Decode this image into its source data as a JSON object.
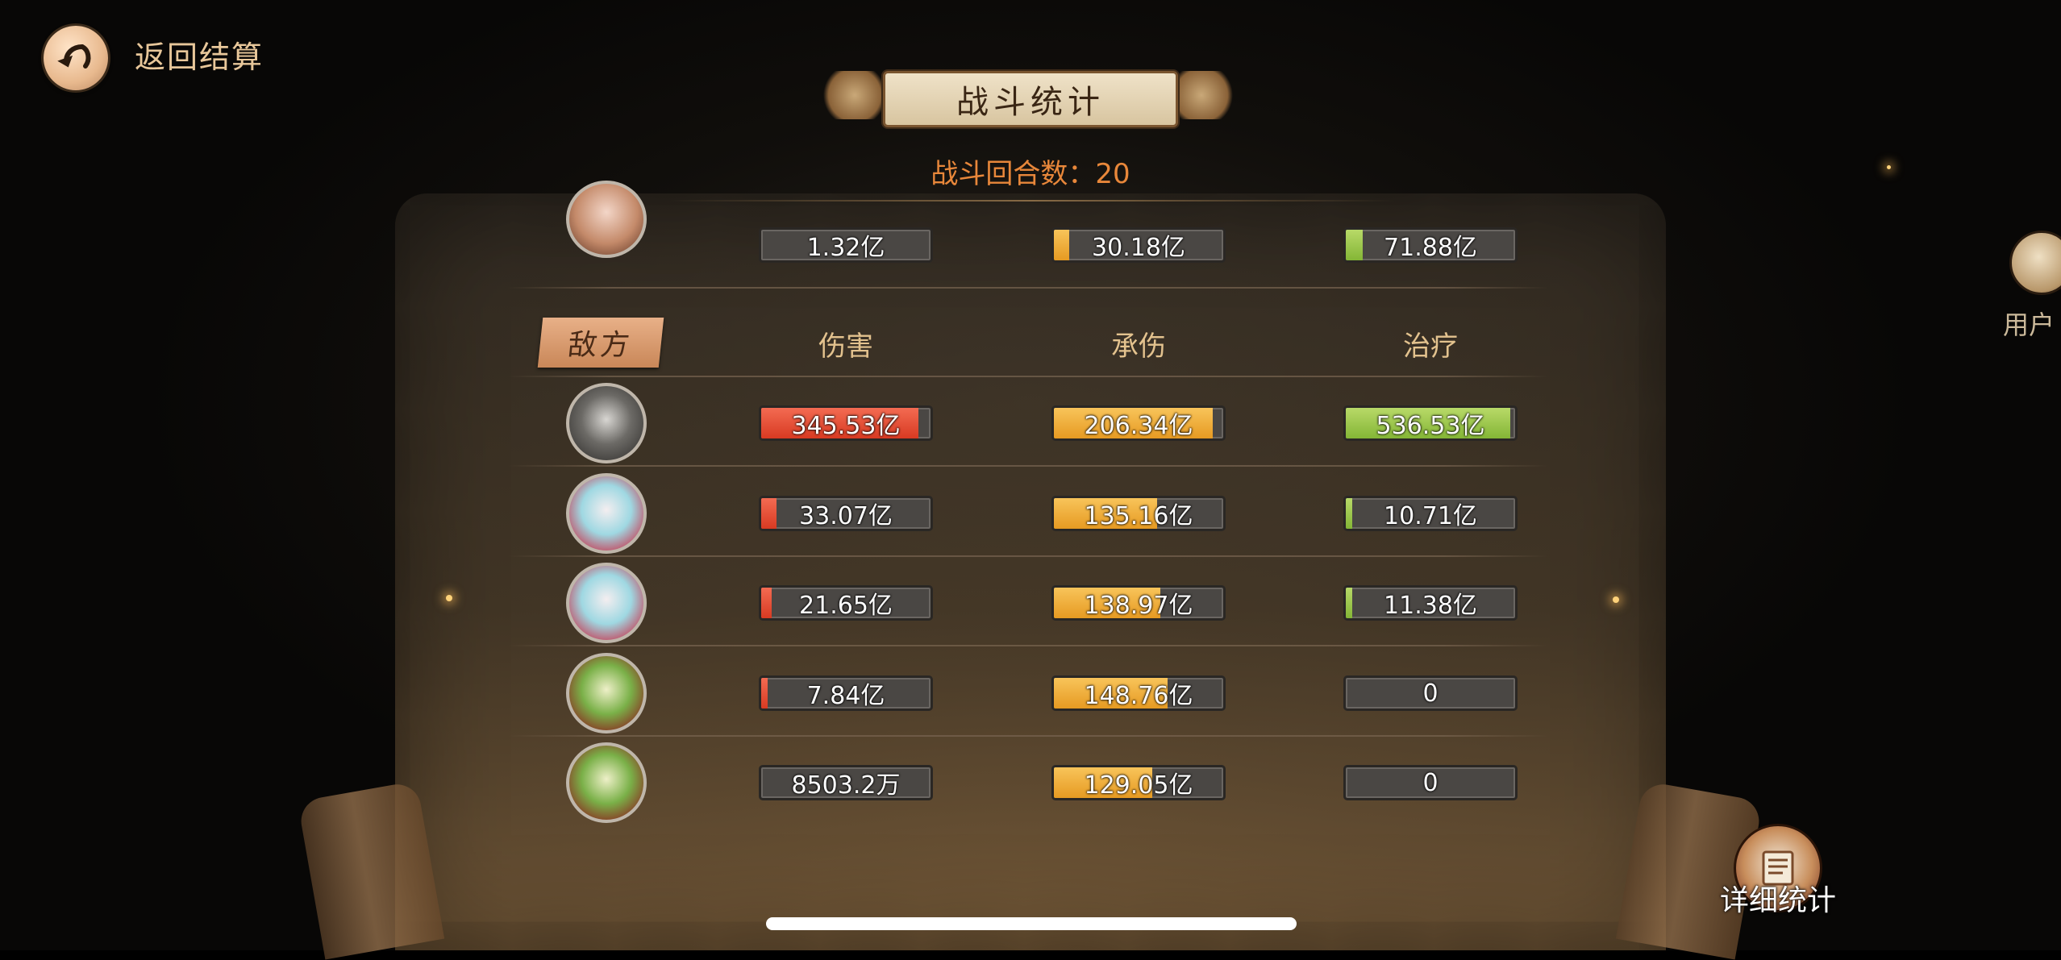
{
  "header": {
    "back_label": "返回结算",
    "title": "战斗统计",
    "rounds_label": "战斗回合数：20"
  },
  "colors": {
    "damage": "#e04a30",
    "taken": "#f0ad3a",
    "healing": "#a6cc52",
    "accent_text": "#e8873a",
    "header_text": "#e3c28e"
  },
  "ally_last_row": {
    "avatar_icon": "female-portrait-icon",
    "damage": {
      "text": "1.32亿",
      "fill": 0
    },
    "taken": {
      "text": "30.18亿",
      "fill": 0.09
    },
    "healing": {
      "text": "71.88亿",
      "fill": 0.1
    }
  },
  "enemy_section": {
    "tag": "敌方",
    "columns": {
      "damage": "伤害",
      "taken": "承伤",
      "healing": "治疗"
    },
    "rows": [
      {
        "avatar_icon": "stone-orbs-boss-icon",
        "damage": {
          "text": "345.53亿",
          "fill": 0.93
        },
        "taken": {
          "text": "206.34亿",
          "fill": 0.94
        },
        "healing": {
          "text": "536.53亿",
          "fill": 0.97
        }
      },
      {
        "avatar_icon": "cyan-hair-girl-icon",
        "damage": {
          "text": "33.07亿",
          "fill": 0.09
        },
        "taken": {
          "text": "135.16亿",
          "fill": 0.61
        },
        "healing": {
          "text": "10.71亿",
          "fill": 0.02
        }
      },
      {
        "avatar_icon": "cyan-hair-girl-icon",
        "damage": {
          "text": "21.65亿",
          "fill": 0.06
        },
        "taken": {
          "text": "138.97亿",
          "fill": 0.63
        },
        "healing": {
          "text": "11.38亿",
          "fill": 0.02
        }
      },
      {
        "avatar_icon": "green-mask-icon",
        "damage": {
          "text": "7.84亿",
          "fill": 0.02
        },
        "taken": {
          "text": "148.76亿",
          "fill": 0.67
        },
        "healing": {
          "text": "0",
          "fill": 0
        }
      },
      {
        "avatar_icon": "green-mask-icon",
        "damage": {
          "text": "8503.2万",
          "fill": 0
        },
        "taken": {
          "text": "129.05亿",
          "fill": 0.58
        },
        "healing": {
          "text": "0",
          "fill": 0
        }
      }
    ]
  },
  "side": {
    "user_label": "用户",
    "detail_label": "详细统计"
  }
}
